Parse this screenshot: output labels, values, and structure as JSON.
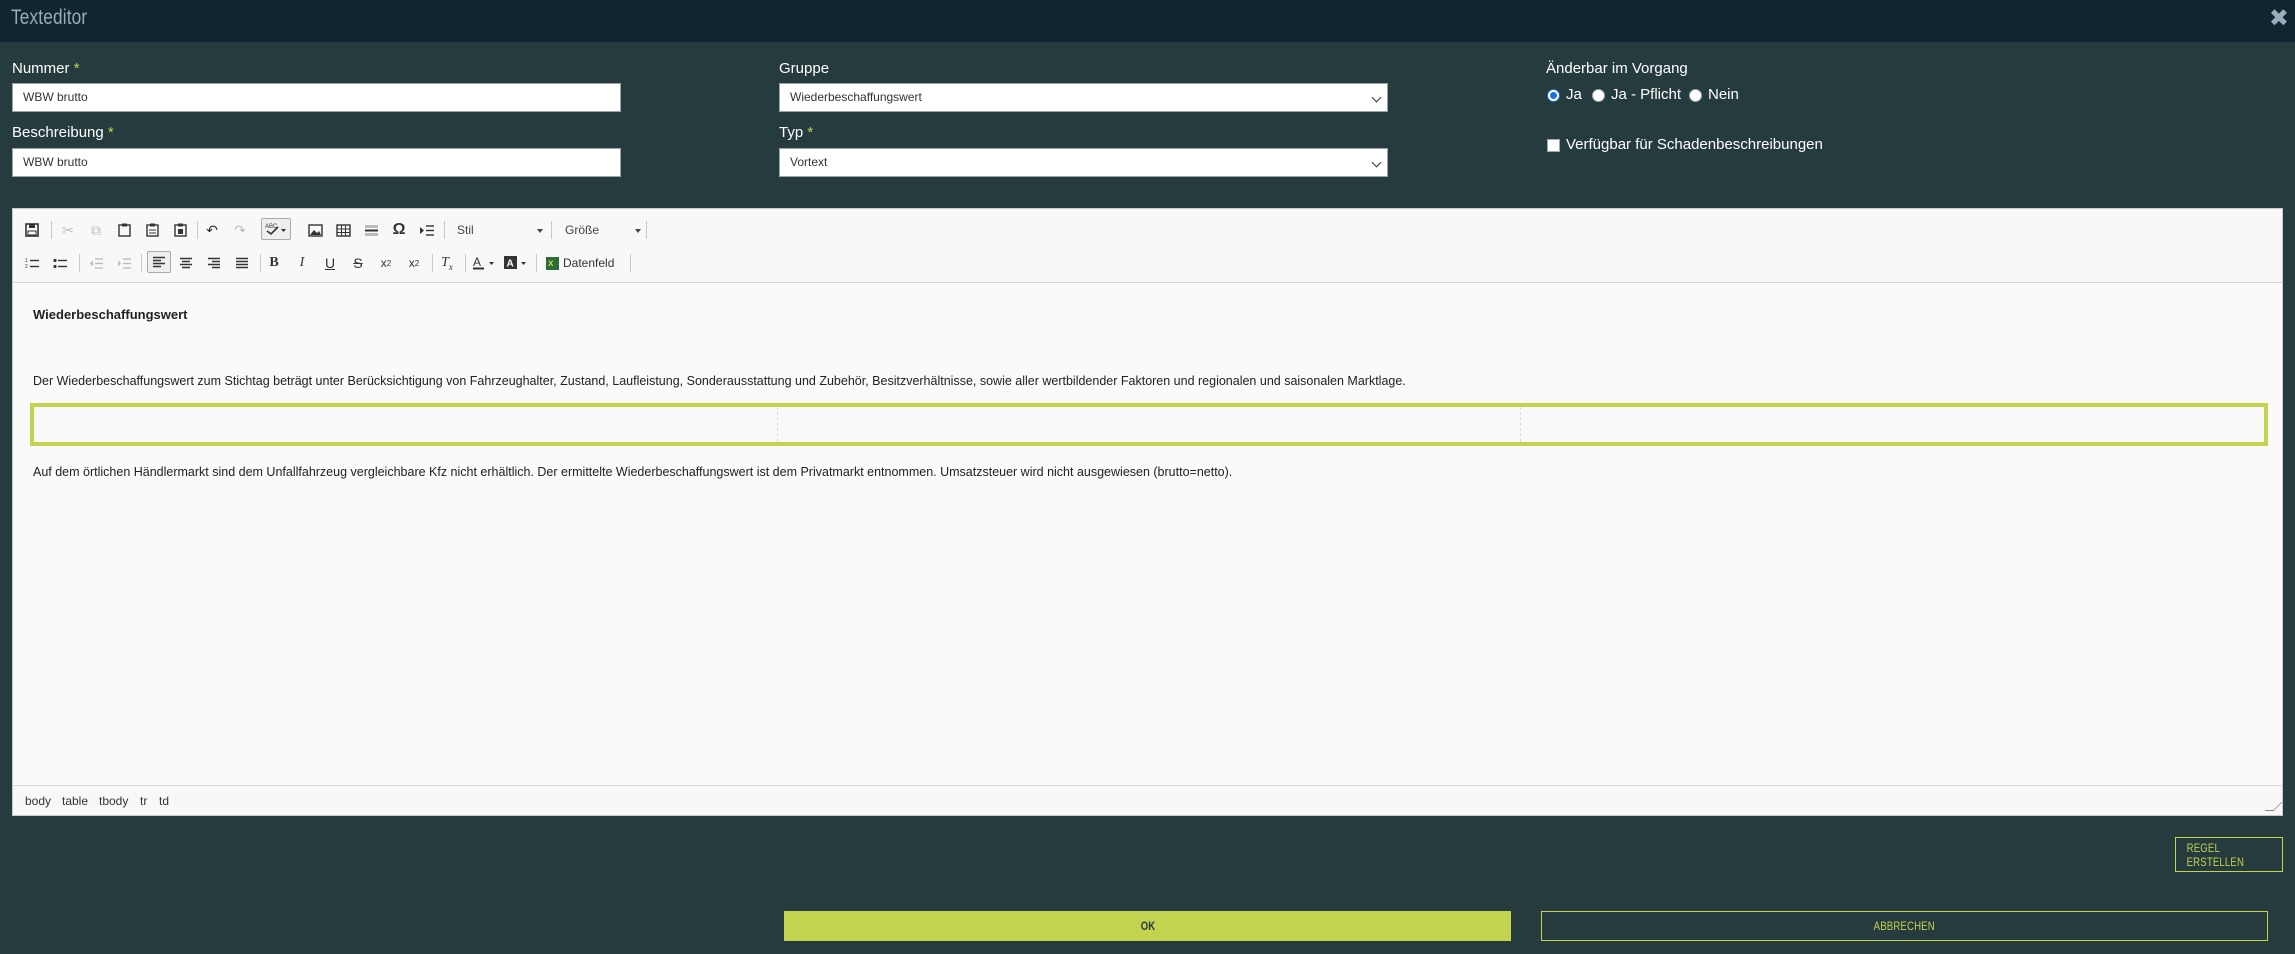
{
  "window": {
    "title": "Texteditor",
    "close_icon": "close-icon"
  },
  "form": {
    "nummer": {
      "label": "Nummer",
      "required": "*",
      "value": "WBW brutto"
    },
    "beschreibung": {
      "label": "Beschreibung",
      "required": "*",
      "value": "WBW brutto"
    },
    "gruppe": {
      "label": "Gruppe",
      "value": "Wiederbeschaffungswert"
    },
    "typ": {
      "label": "Typ",
      "required": "*",
      "value": "Vortext"
    },
    "aenderbar": {
      "label": "Änderbar im Vorgang",
      "options": [
        "Ja",
        "Ja - Pflicht",
        "Nein"
      ],
      "selected": "Ja"
    },
    "verfuegbar": {
      "label": "Verfügbar für Schadenbeschreibungen",
      "checked": false
    }
  },
  "toolbar": {
    "style_label": "Stil",
    "size_label": "Größe",
    "datafield_label": "Datenfeld"
  },
  "editor": {
    "heading": "Wiederbeschaffungswert",
    "para1": "Der Wiederbeschaffungswert zum Stichtag beträgt unter Berücksichtigung von Fahrzeughalter, Zustand, Laufleistung, Sonderausstattung und Zubehör, Besitzverhältnisse, sowie aller wertbildender Faktoren und regionalen und saisonalen Marktlage.",
    "para2": "Auf dem örtlichen Händlermarkt sind dem Unfallfahrzeug vergleichbare Kfz nicht erhältlich. Der ermittelte Wiederbeschaffungswert ist dem Privatmarkt entnommen. Umsatzsteuer wird nicht ausgewiesen (brutto=netto).",
    "path": [
      "body",
      "table",
      "tbody",
      "tr",
      "td"
    ]
  },
  "buttons": {
    "regel": "REGEL ERSTELLEN",
    "ok": "OK",
    "abbrechen": "ABBRECHEN"
  },
  "colors": {
    "accent": "#c3d350",
    "background": "#263b3e",
    "titlebar": "#10252f"
  }
}
